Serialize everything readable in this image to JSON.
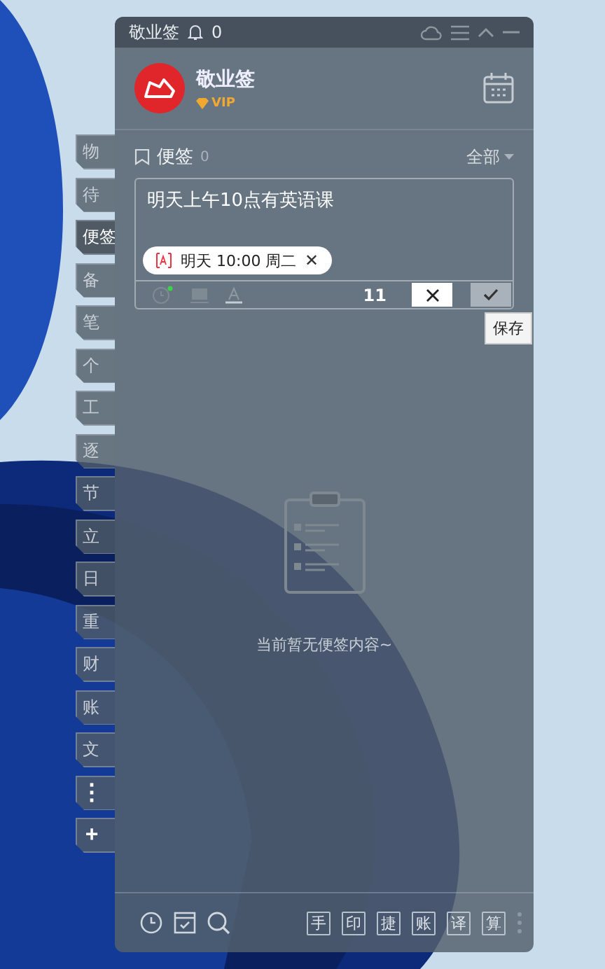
{
  "titlebar": {
    "title": "敬业签",
    "notification_count": "0"
  },
  "profile": {
    "name": "敬业签",
    "badge": "VIP"
  },
  "section": {
    "title": "便签",
    "count": "0",
    "filter": "全部"
  },
  "editor": {
    "value": "明天上午10点有英语课",
    "reminder_chip": "明天 10:00 周二",
    "chip_close": "✕",
    "char_count": "11",
    "reminder_set": true
  },
  "tooltip": "保存",
  "side_tabs": [
    {
      "label": "物",
      "selected": false
    },
    {
      "label": "待",
      "selected": false
    },
    {
      "label": "便签",
      "selected": true
    },
    {
      "label": "备",
      "selected": false
    },
    {
      "label": "笔",
      "selected": false
    },
    {
      "label": "个",
      "selected": false
    },
    {
      "label": "工",
      "selected": false
    },
    {
      "label": "逐",
      "selected": false
    },
    {
      "label": "节",
      "selected": false
    },
    {
      "label": "立",
      "selected": false
    },
    {
      "label": "日",
      "selected": false
    },
    {
      "label": "重",
      "selected": false
    },
    {
      "label": "财",
      "selected": false
    },
    {
      "label": "账",
      "selected": false
    },
    {
      "label": "文",
      "selected": false
    }
  ],
  "side_actions": [
    "⋮",
    "+"
  ],
  "empty_state": "当前暂无便签内容~",
  "bottom_tools": [
    "手",
    "印",
    "捷",
    "账",
    "译",
    "算"
  ]
}
